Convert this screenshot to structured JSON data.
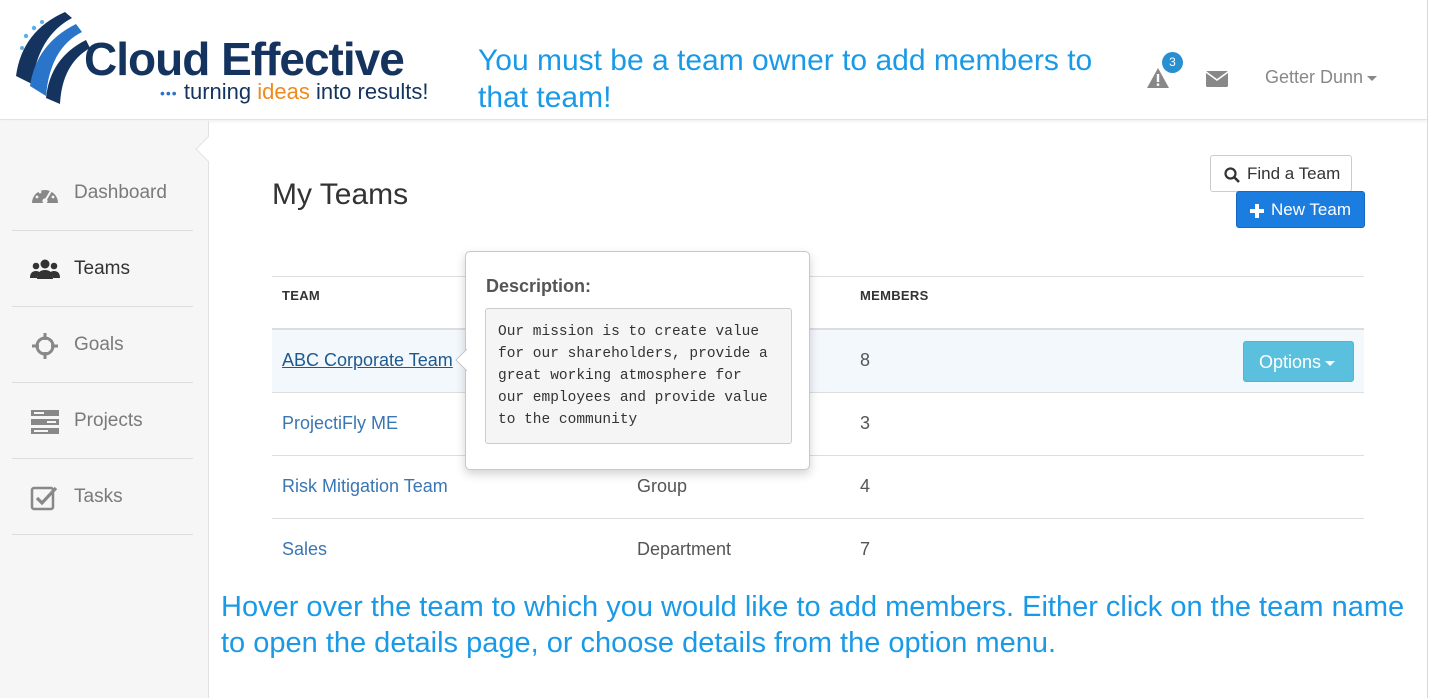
{
  "header": {
    "logo": {
      "title": "Cloud Effective",
      "tagline_pre": "turning ",
      "tagline_hl": "ideas",
      "tagline_post": " into results!",
      "dots": "•••"
    },
    "alert_count": "3",
    "user_name": "Getter Dunn"
  },
  "annotations": {
    "top": "You must be a team owner to add members to that team!",
    "bottom": "Hover over the team to which you would like to add members.  Either click on the team name to open the details page, or choose details from the option menu."
  },
  "sidebar": {
    "items": [
      {
        "label": "Dashboard",
        "icon": "dashboard-icon"
      },
      {
        "label": "Teams",
        "icon": "users-icon",
        "active": true
      },
      {
        "label": "Goals",
        "icon": "crosshair-icon"
      },
      {
        "label": "Projects",
        "icon": "projects-icon"
      },
      {
        "label": "Tasks",
        "icon": "check-square-icon"
      }
    ]
  },
  "main": {
    "title": "My Teams",
    "find_label": "Find a Team",
    "new_label": "New Team",
    "table": {
      "headers": {
        "team": "TEAM",
        "members": "MEMBERS"
      },
      "rows": [
        {
          "team": "ABC Corporate Team",
          "type": "",
          "members": "8"
        },
        {
          "team": "ProjectiFly ME",
          "type": "",
          "members": "3"
        },
        {
          "team": "Risk Mitigation Team",
          "type": "Group",
          "members": "4"
        },
        {
          "team": "Sales",
          "type": "Department",
          "members": "7"
        }
      ],
      "options_label": "Options"
    },
    "popover": {
      "title": "Description:",
      "body": "Our mission is to create value\nfor our shareholders, provide a\ngreat working atmosphere for\nour employees and provide value\nto the community"
    }
  },
  "colors": {
    "annotation": "#1a9ae6",
    "primary": "#1c7de0",
    "info": "#5bc0de",
    "brand": "#14345f"
  }
}
